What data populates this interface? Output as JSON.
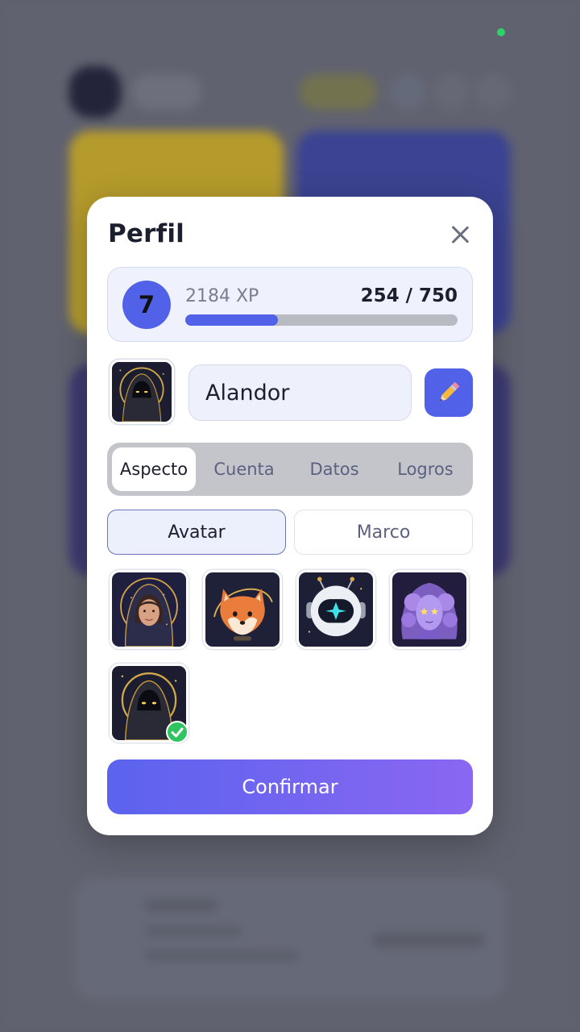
{
  "modal": {
    "title": "Perfil",
    "close_icon": "close-icon"
  },
  "xp": {
    "level": "7",
    "total": "2184 XP",
    "progress_text": "254 / 750",
    "progress_fraction": 0.339
  },
  "profile": {
    "avatar_icon": "hooded-figure-avatar",
    "name": "Alandor",
    "edit_icon": "pencil-icon"
  },
  "tabs": [
    {
      "label": "Aspecto",
      "active": true
    },
    {
      "label": "Cuenta",
      "active": false
    },
    {
      "label": "Datos",
      "active": false
    },
    {
      "label": "Logros",
      "active": false
    }
  ],
  "subtabs": [
    {
      "label": "Avatar",
      "active": true
    },
    {
      "label": "Marco",
      "active": false
    }
  ],
  "avatars": [
    {
      "name": "woman-hood-avatar",
      "selected": false
    },
    {
      "name": "fox-avatar",
      "selected": false
    },
    {
      "name": "robot-avatar",
      "selected": false
    },
    {
      "name": "purple-nebula-avatar",
      "selected": false
    },
    {
      "name": "hooded-figure-avatar",
      "selected": true
    }
  ],
  "confirm_label": "Confirmar",
  "colors": {
    "accent": "#5162e8",
    "success": "#2fc45f",
    "button_gradient_start": "#5b63ee",
    "button_gradient_end": "#8a67f2"
  }
}
